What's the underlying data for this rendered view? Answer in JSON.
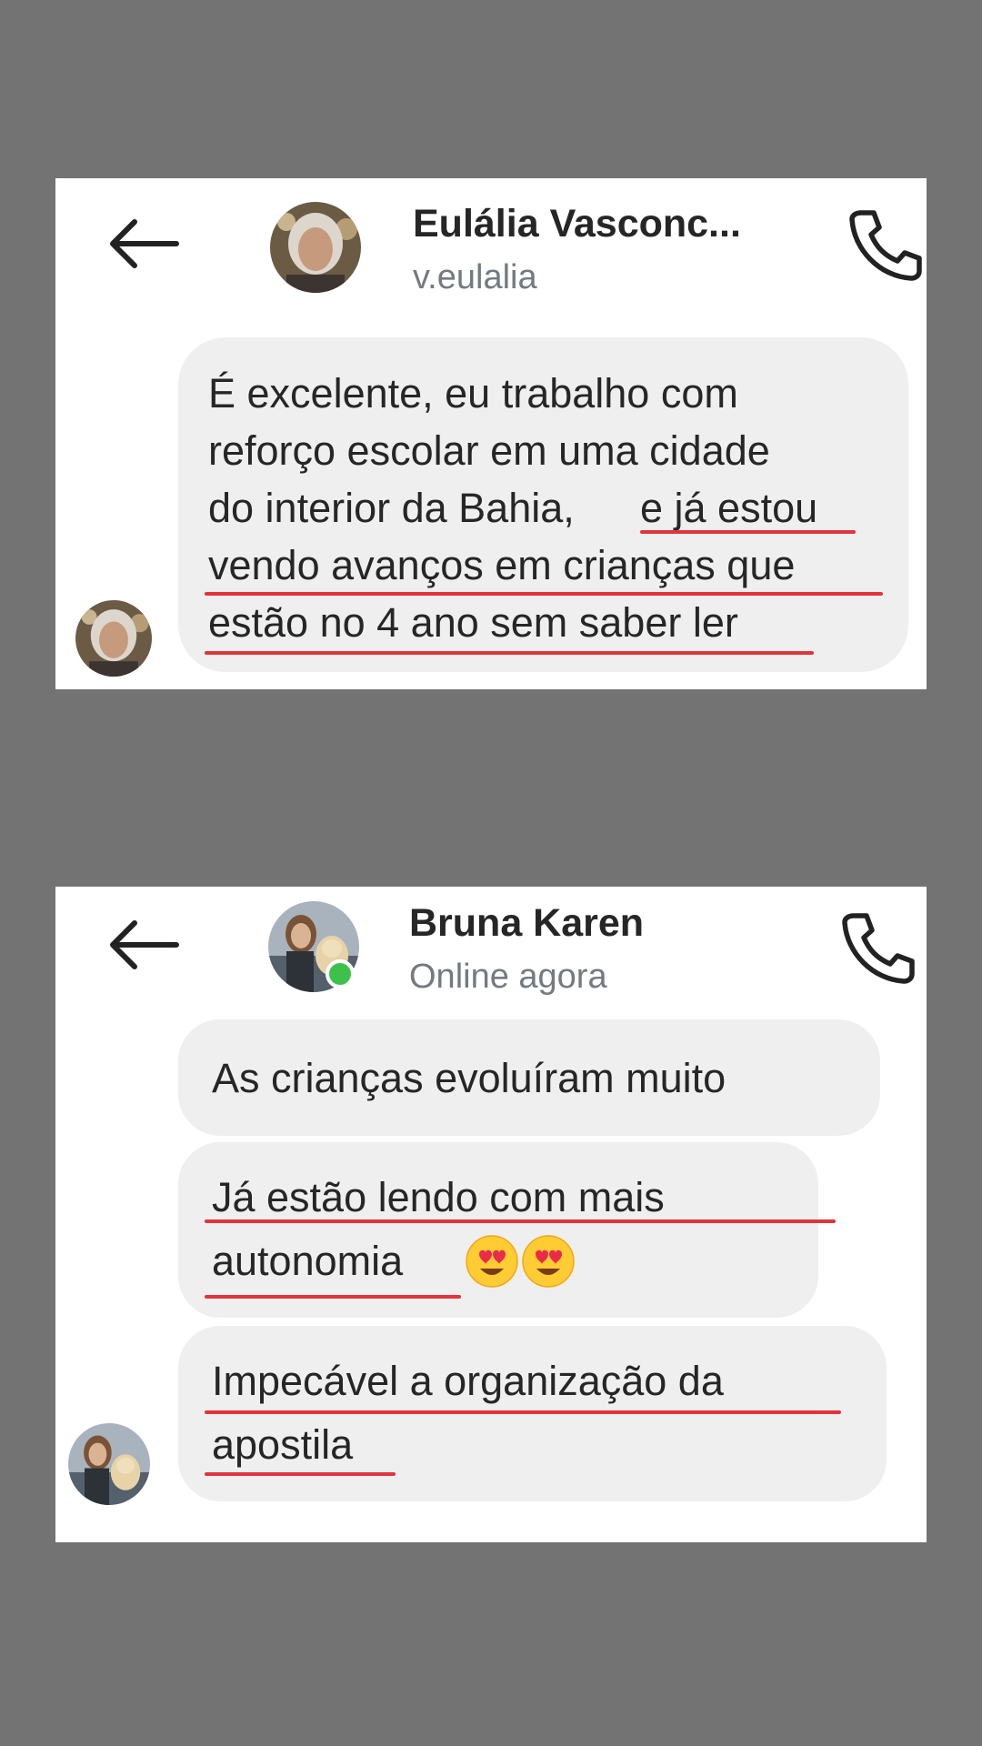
{
  "conversation_1": {
    "contact_name": "Eulália Vasconc...",
    "username": "v.eulalia",
    "message_lines": [
      "É excelente,  eu trabalho com",
      "reforço escolar em uma cidade",
      "do interior da Bahia,",
      "e já estou",
      "vendo avanços em crianças que",
      "estão no 4 ano sem saber ler"
    ]
  },
  "conversation_2": {
    "contact_name": "Bruna Karen",
    "status": "Online agora",
    "messages": [
      {
        "lines": [
          "As crianças evoluíram muito"
        ]
      },
      {
        "lines": [
          "Já estão lendo com mais",
          "autonomia"
        ],
        "emoji": [
          "heart-eyes",
          "heart-eyes"
        ]
      },
      {
        "lines": [
          "Impecável a organização da",
          "apostila"
        ]
      }
    ]
  },
  "colors": {
    "background": "#737373",
    "card": "#ffffff",
    "bubble": "#efefef",
    "underline": "#e2343c",
    "online": "#3ec14a"
  },
  "icons": [
    "back-arrow-icon",
    "phone-icon",
    "heart-eyes-emoji"
  ]
}
